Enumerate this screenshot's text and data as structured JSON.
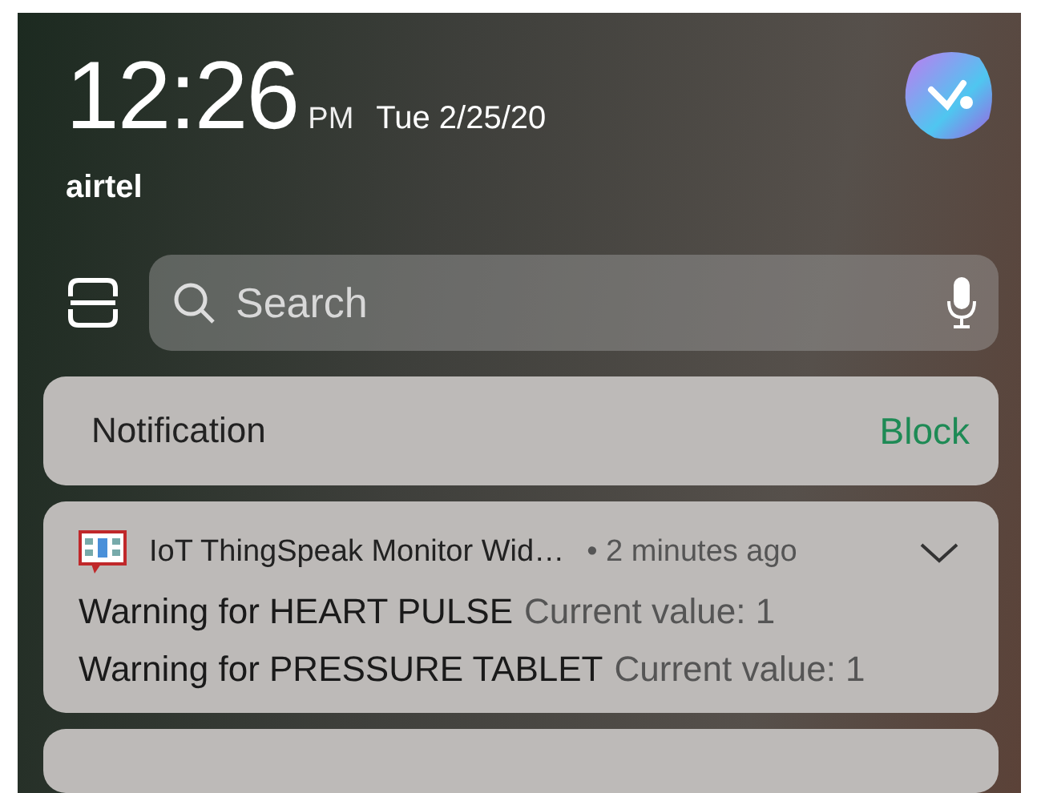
{
  "status": {
    "time": "12:26",
    "ampm": "PM",
    "date": "Tue 2/25/20",
    "carrier": "airtel"
  },
  "search": {
    "placeholder": "Search"
  },
  "notification_bar": {
    "label": "Notification",
    "action": "Block"
  },
  "notification": {
    "app": "IoT ThingSpeak Monitor Wid…",
    "time": "• 2 minutes ago",
    "expanded": false,
    "lines": [
      {
        "title": "Warning for HEART PULSE",
        "value": "Current value: 1"
      },
      {
        "title": "Warning for PRESSURE TABLET",
        "value": "Current value: 1"
      }
    ]
  }
}
